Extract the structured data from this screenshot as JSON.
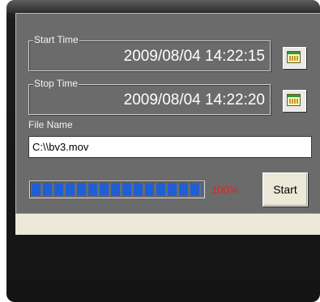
{
  "start_group": {
    "title": "Start Time",
    "value": "2009/08/04 14:22:15",
    "calendar_icon": "calendar-icon"
  },
  "stop_group": {
    "title": "Stop Time",
    "value": "2009/08/04 14:22:20",
    "calendar_icon": "calendar-icon"
  },
  "file": {
    "label": "File Name",
    "value": "C:\\\\bv3.mov"
  },
  "progress": {
    "value": 1.0,
    "percent_label": "100%"
  },
  "actions": {
    "start_label": "Start"
  },
  "colors": {
    "progress_fill": "#1f5fd6",
    "percent_text": "#e22424",
    "panel": "#6b6b6b"
  }
}
